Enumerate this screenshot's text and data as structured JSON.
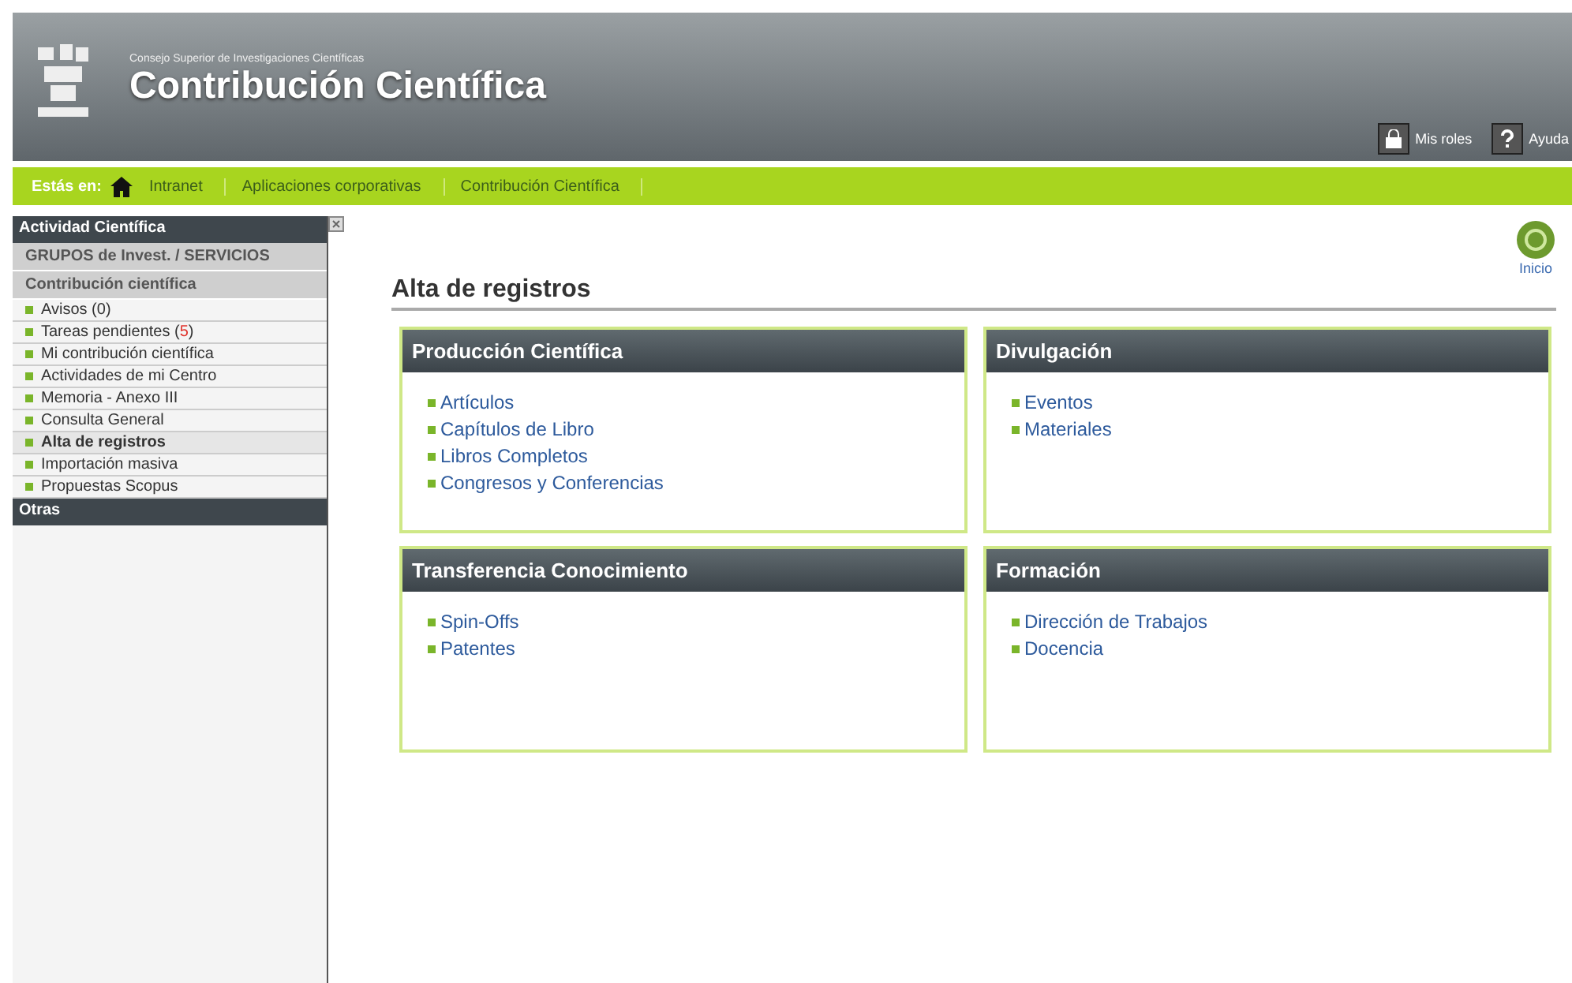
{
  "header": {
    "org": "Consejo Superior de Investigaciones Científicas",
    "title": "Contribución Científica",
    "actions": [
      {
        "kind": "lock",
        "label": "Mis roles"
      },
      {
        "kind": "help",
        "label": "Ayuda"
      }
    ]
  },
  "breadcrumb": {
    "label": "Estás en:",
    "items": [
      "Intranet",
      "Aplicaciones corporativas",
      "Contribución Científica"
    ]
  },
  "sidebar": {
    "sections": [
      {
        "kind": "header",
        "label": "Actividad Científica"
      },
      {
        "kind": "group",
        "label": "GRUPOS de Invest. / SERVICIOS"
      },
      {
        "kind": "group",
        "label": "Contribución científica"
      },
      {
        "kind": "item",
        "label": "Avisos (0)",
        "selected": false
      },
      {
        "kind": "item",
        "label": "Tareas pendientes (",
        "alert": "5",
        "suffix": ")",
        "selected": false
      },
      {
        "kind": "item",
        "label": "Mi contribución científica",
        "selected": false
      },
      {
        "kind": "item",
        "label": "Actividades de mi Centro",
        "selected": false
      },
      {
        "kind": "item",
        "label": "Memoria - Anexo III",
        "selected": false
      },
      {
        "kind": "item",
        "label": "Consulta General",
        "selected": false
      },
      {
        "kind": "item",
        "label": "Alta de registros",
        "selected": true
      },
      {
        "kind": "item",
        "label": "Importación masiva",
        "selected": false
      },
      {
        "kind": "item",
        "label": "Propuestas Scopus",
        "selected": false
      },
      {
        "kind": "header",
        "label": "Otras"
      }
    ]
  },
  "home": {
    "label": "Inicio"
  },
  "page_title": "Alta de registros",
  "panels": [
    {
      "title": "Producción Científica",
      "links": [
        "Artículos",
        "Capítulos de Libro",
        "Libros Completos",
        "Congresos y Conferencias"
      ]
    },
    {
      "title": "Divulgación",
      "links": [
        "Eventos",
        "Materiales"
      ]
    },
    {
      "title": "Transferencia Conocimiento",
      "links": [
        "Spin-Offs",
        "Patentes"
      ]
    },
    {
      "title": "Formación",
      "links": [
        "Dirección de Trabajos",
        "Docencia"
      ]
    }
  ]
}
